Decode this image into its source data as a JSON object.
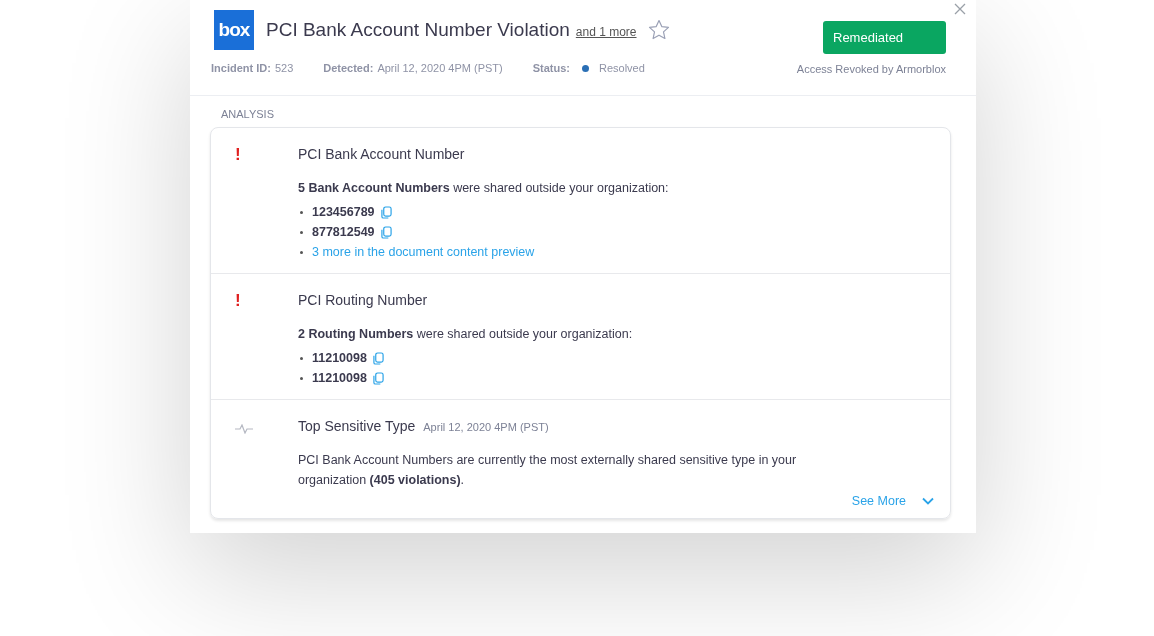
{
  "header": {
    "logo": "box",
    "title": "PCI Bank Account Number Violation",
    "more_link": "and 1 more",
    "starred": false,
    "meta": [
      {
        "label": "Incident ID:",
        "value": "523",
        "kind": "text"
      },
      {
        "label": "Detected:",
        "value": "April 12, 2020 4PM (PST)",
        "kind": "text"
      },
      {
        "label": "Status:",
        "value": "Resolved",
        "kind": "status"
      }
    ],
    "action_button": "Remediated",
    "action_note": "Access Revoked by Armorblox"
  },
  "section_label": "ANALYSIS",
  "findings": [
    {
      "kind": "alert",
      "icon": "!",
      "title": "PCI Bank Account Number",
      "summary": "**5 Bank Account Numbers** were shared outside your organization:",
      "items": [
        {
          "kind": "value",
          "text": "123456789"
        },
        {
          "kind": "value",
          "text": "877812549"
        },
        {
          "kind": "link",
          "text": "3 more in the document content preview"
        }
      ]
    },
    {
      "kind": "alert",
      "icon": "!",
      "title": "PCI Routing Number",
      "summary": "**2 Routing Numbers** were shared outside your organization:",
      "items": [
        {
          "kind": "value",
          "text": "11210098"
        },
        {
          "kind": "value",
          "text": "11210098"
        }
      ]
    },
    {
      "kind": "insight",
      "title": "Top Sensitive Type",
      "date": "April 12, 2020 4PM (PST)",
      "summary": "PCI Bank Account Numbers are currently the most externally shared sensitive type in your organization **(405 violations)**.",
      "link": "See More"
    }
  ]
}
